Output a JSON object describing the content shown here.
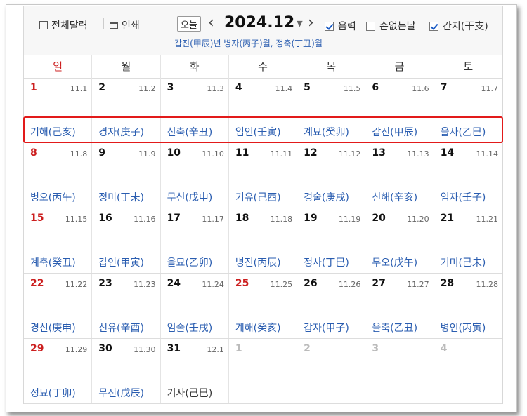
{
  "toolbar": {
    "full_calendar_label": "전체달력",
    "print_label": "인쇄",
    "today_label": "오늘",
    "month_label": "2024.12",
    "lunar_label": "음력",
    "no_loss_day_label": "손없는날",
    "ganji_label": "간지(干支)",
    "lunar_checked": true,
    "no_loss_day_checked": false,
    "ganji_checked": true
  },
  "subtitle": "갑진(甲辰)년 병자(丙子)월, 정축(丁丑)월",
  "weekdays": [
    "일",
    "월",
    "화",
    "수",
    "목",
    "금",
    "토"
  ],
  "weeks": [
    [
      {
        "day": "1",
        "lunar": "11.1",
        "ganji": "기해(己亥)"
      },
      {
        "day": "2",
        "lunar": "11.2",
        "ganji": "경자(庚子)"
      },
      {
        "day": "3",
        "lunar": "11.3",
        "ganji": "신축(辛丑)"
      },
      {
        "day": "4",
        "lunar": "11.4",
        "ganji": "임인(壬寅)"
      },
      {
        "day": "5",
        "lunar": "11.5",
        "ganji": "계묘(癸卯)"
      },
      {
        "day": "6",
        "lunar": "11.6",
        "ganji": "갑진(甲辰)"
      },
      {
        "day": "7",
        "lunar": "11.7",
        "ganji": "을사(乙巳)"
      }
    ],
    [
      {
        "day": "8",
        "lunar": "11.8",
        "ganji": "병오(丙午)"
      },
      {
        "day": "9",
        "lunar": "11.9",
        "ganji": "정미(丁未)"
      },
      {
        "day": "10",
        "lunar": "11.10",
        "ganji": "무신(戊申)"
      },
      {
        "day": "11",
        "lunar": "11.11",
        "ganji": "기유(己酉)"
      },
      {
        "day": "12",
        "lunar": "11.12",
        "ganji": "경술(庚戌)"
      },
      {
        "day": "13",
        "lunar": "11.13",
        "ganji": "신해(辛亥)"
      },
      {
        "day": "14",
        "lunar": "11.14",
        "ganji": "임자(壬子)"
      }
    ],
    [
      {
        "day": "15",
        "lunar": "11.15",
        "ganji": "계축(癸丑)"
      },
      {
        "day": "16",
        "lunar": "11.16",
        "ganji": "갑인(甲寅)"
      },
      {
        "day": "17",
        "lunar": "11.17",
        "ganji": "을묘(乙卯)"
      },
      {
        "day": "18",
        "lunar": "11.18",
        "ganji": "병진(丙辰)"
      },
      {
        "day": "19",
        "lunar": "11.19",
        "ganji": "정사(丁巳)"
      },
      {
        "day": "20",
        "lunar": "11.20",
        "ganji": "무오(戊午)"
      },
      {
        "day": "21",
        "lunar": "11.21",
        "ganji": "기미(己未)"
      }
    ],
    [
      {
        "day": "22",
        "lunar": "11.22",
        "ganji": "경신(庚申)"
      },
      {
        "day": "23",
        "lunar": "11.23",
        "ganji": "신유(辛酉)"
      },
      {
        "day": "24",
        "lunar": "11.24",
        "ganji": "임술(壬戌)"
      },
      {
        "day": "25",
        "lunar": "11.25",
        "ganji": "계해(癸亥)",
        "holiday": true
      },
      {
        "day": "26",
        "lunar": "11.26",
        "ganji": "갑자(甲子)"
      },
      {
        "day": "27",
        "lunar": "11.27",
        "ganji": "을축(乙丑)"
      },
      {
        "day": "28",
        "lunar": "11.28",
        "ganji": "병인(丙寅)"
      }
    ],
    [
      {
        "day": "29",
        "lunar": "11.29",
        "ganji": "정묘(丁卯)"
      },
      {
        "day": "30",
        "lunar": "11.30",
        "ganji": "무진(戊辰)"
      },
      {
        "day": "31",
        "lunar": "12.1",
        "ganji": "기사(己巳)",
        "ganji_dark": true
      },
      {
        "day": "1",
        "lunar": "",
        "ganji": "",
        "other_month": true
      },
      {
        "day": "2",
        "lunar": "",
        "ganji": "",
        "other_month": true
      },
      {
        "day": "3",
        "lunar": "",
        "ganji": "",
        "other_month": true
      },
      {
        "day": "4",
        "lunar": "",
        "ganji": "",
        "other_month": true
      }
    ]
  ],
  "colors": {
    "sunday_red": "#cc1f1f",
    "ganji_blue": "#2a5db0",
    "highlight_red": "#e21a1a"
  }
}
